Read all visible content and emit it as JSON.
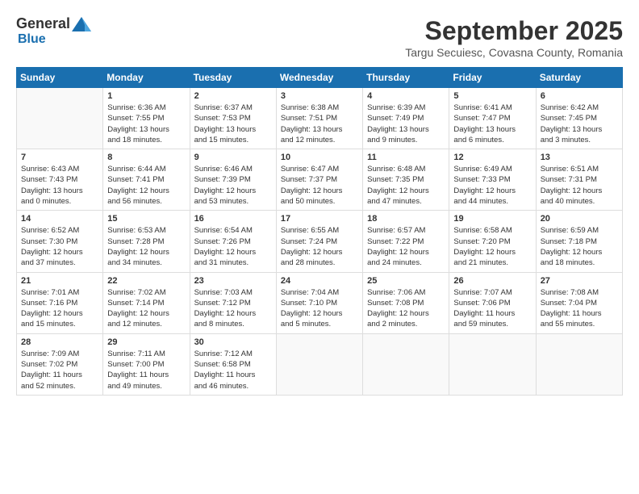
{
  "header": {
    "logo_general": "General",
    "logo_blue": "Blue",
    "month_title": "September 2025",
    "location": "Targu Secuiesc, Covasna County, Romania"
  },
  "days_of_week": [
    "Sunday",
    "Monday",
    "Tuesday",
    "Wednesday",
    "Thursday",
    "Friday",
    "Saturday"
  ],
  "weeks": [
    [
      {
        "day": "",
        "info": ""
      },
      {
        "day": "1",
        "info": "Sunrise: 6:36 AM\nSunset: 7:55 PM\nDaylight: 13 hours\nand 18 minutes."
      },
      {
        "day": "2",
        "info": "Sunrise: 6:37 AM\nSunset: 7:53 PM\nDaylight: 13 hours\nand 15 minutes."
      },
      {
        "day": "3",
        "info": "Sunrise: 6:38 AM\nSunset: 7:51 PM\nDaylight: 13 hours\nand 12 minutes."
      },
      {
        "day": "4",
        "info": "Sunrise: 6:39 AM\nSunset: 7:49 PM\nDaylight: 13 hours\nand 9 minutes."
      },
      {
        "day": "5",
        "info": "Sunrise: 6:41 AM\nSunset: 7:47 PM\nDaylight: 13 hours\nand 6 minutes."
      },
      {
        "day": "6",
        "info": "Sunrise: 6:42 AM\nSunset: 7:45 PM\nDaylight: 13 hours\nand 3 minutes."
      }
    ],
    [
      {
        "day": "7",
        "info": "Sunrise: 6:43 AM\nSunset: 7:43 PM\nDaylight: 13 hours\nand 0 minutes."
      },
      {
        "day": "8",
        "info": "Sunrise: 6:44 AM\nSunset: 7:41 PM\nDaylight: 12 hours\nand 56 minutes."
      },
      {
        "day": "9",
        "info": "Sunrise: 6:46 AM\nSunset: 7:39 PM\nDaylight: 12 hours\nand 53 minutes."
      },
      {
        "day": "10",
        "info": "Sunrise: 6:47 AM\nSunset: 7:37 PM\nDaylight: 12 hours\nand 50 minutes."
      },
      {
        "day": "11",
        "info": "Sunrise: 6:48 AM\nSunset: 7:35 PM\nDaylight: 12 hours\nand 47 minutes."
      },
      {
        "day": "12",
        "info": "Sunrise: 6:49 AM\nSunset: 7:33 PM\nDaylight: 12 hours\nand 44 minutes."
      },
      {
        "day": "13",
        "info": "Sunrise: 6:51 AM\nSunset: 7:31 PM\nDaylight: 12 hours\nand 40 minutes."
      }
    ],
    [
      {
        "day": "14",
        "info": "Sunrise: 6:52 AM\nSunset: 7:30 PM\nDaylight: 12 hours\nand 37 minutes."
      },
      {
        "day": "15",
        "info": "Sunrise: 6:53 AM\nSunset: 7:28 PM\nDaylight: 12 hours\nand 34 minutes."
      },
      {
        "day": "16",
        "info": "Sunrise: 6:54 AM\nSunset: 7:26 PM\nDaylight: 12 hours\nand 31 minutes."
      },
      {
        "day": "17",
        "info": "Sunrise: 6:55 AM\nSunset: 7:24 PM\nDaylight: 12 hours\nand 28 minutes."
      },
      {
        "day": "18",
        "info": "Sunrise: 6:57 AM\nSunset: 7:22 PM\nDaylight: 12 hours\nand 24 minutes."
      },
      {
        "day": "19",
        "info": "Sunrise: 6:58 AM\nSunset: 7:20 PM\nDaylight: 12 hours\nand 21 minutes."
      },
      {
        "day": "20",
        "info": "Sunrise: 6:59 AM\nSunset: 7:18 PM\nDaylight: 12 hours\nand 18 minutes."
      }
    ],
    [
      {
        "day": "21",
        "info": "Sunrise: 7:01 AM\nSunset: 7:16 PM\nDaylight: 12 hours\nand 15 minutes."
      },
      {
        "day": "22",
        "info": "Sunrise: 7:02 AM\nSunset: 7:14 PM\nDaylight: 12 hours\nand 12 minutes."
      },
      {
        "day": "23",
        "info": "Sunrise: 7:03 AM\nSunset: 7:12 PM\nDaylight: 12 hours\nand 8 minutes."
      },
      {
        "day": "24",
        "info": "Sunrise: 7:04 AM\nSunset: 7:10 PM\nDaylight: 12 hours\nand 5 minutes."
      },
      {
        "day": "25",
        "info": "Sunrise: 7:06 AM\nSunset: 7:08 PM\nDaylight: 12 hours\nand 2 minutes."
      },
      {
        "day": "26",
        "info": "Sunrise: 7:07 AM\nSunset: 7:06 PM\nDaylight: 11 hours\nand 59 minutes."
      },
      {
        "day": "27",
        "info": "Sunrise: 7:08 AM\nSunset: 7:04 PM\nDaylight: 11 hours\nand 55 minutes."
      }
    ],
    [
      {
        "day": "28",
        "info": "Sunrise: 7:09 AM\nSunset: 7:02 PM\nDaylight: 11 hours\nand 52 minutes."
      },
      {
        "day": "29",
        "info": "Sunrise: 7:11 AM\nSunset: 7:00 PM\nDaylight: 11 hours\nand 49 minutes."
      },
      {
        "day": "30",
        "info": "Sunrise: 7:12 AM\nSunset: 6:58 PM\nDaylight: 11 hours\nand 46 minutes."
      },
      {
        "day": "",
        "info": ""
      },
      {
        "day": "",
        "info": ""
      },
      {
        "day": "",
        "info": ""
      },
      {
        "day": "",
        "info": ""
      }
    ]
  ]
}
